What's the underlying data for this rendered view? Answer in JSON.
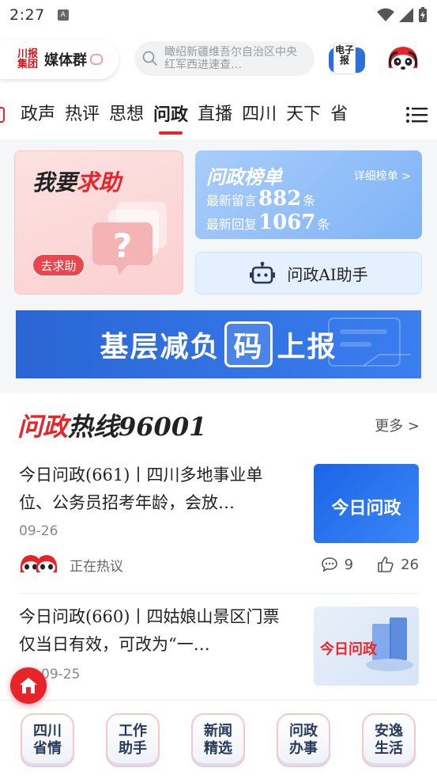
{
  "status_bar": {
    "time": "2:27"
  },
  "header": {
    "group_logo": "川报集团",
    "group_name": "媒体群",
    "search_placeholder": "瞰绍新疆维吾尔自治区中央红军西进速查…",
    "epaper_label": "电子报"
  },
  "tabs": [
    "政声",
    "热评",
    "思想",
    "问政",
    "直播",
    "四川",
    "天下",
    "省"
  ],
  "active_tab": "问政",
  "help_card": {
    "title_black": "我要",
    "title_red": "求助",
    "button": "去求助"
  },
  "rank_card": {
    "title": "问政榜单",
    "detail": "详细榜单 >",
    "latest_message_label": "最新留言",
    "latest_message_count": "882",
    "latest_reply_label": "最新回复",
    "latest_reply_count": "1067",
    "unit": "条"
  },
  "ai_card": {
    "label": "问政AI助手"
  },
  "banner": {
    "prefix": "基层减负",
    "highlight": "码",
    "suffix": "上报"
  },
  "section": {
    "title_red": "问政",
    "title_black": "热线96001",
    "more": "更多 >"
  },
  "news": [
    {
      "title": "今日问政(661)丨四川多地事业单位、公务员招考年龄，会放…",
      "date": "09-26",
      "status": "正在热议",
      "comments": "9",
      "likes": "26",
      "thumb_text": "今日问政"
    },
    {
      "title": "今日问政(660)丨四姑娘山景区门票仅当日有效，可改为“一…",
      "date": "09-25",
      "thumb_text": "今日问政"
    }
  ],
  "bottom_bar": [
    {
      "line1": "四川",
      "line2": "省情"
    },
    {
      "line1": "工作",
      "line2": "助手"
    },
    {
      "line1": "新闻",
      "line2": "精选"
    },
    {
      "line1": "问政",
      "line2": "办事"
    },
    {
      "line1": "安逸",
      "line2": "生活"
    }
  ],
  "colors": {
    "accent": "#e8242b",
    "blue": "#2e6edb"
  }
}
